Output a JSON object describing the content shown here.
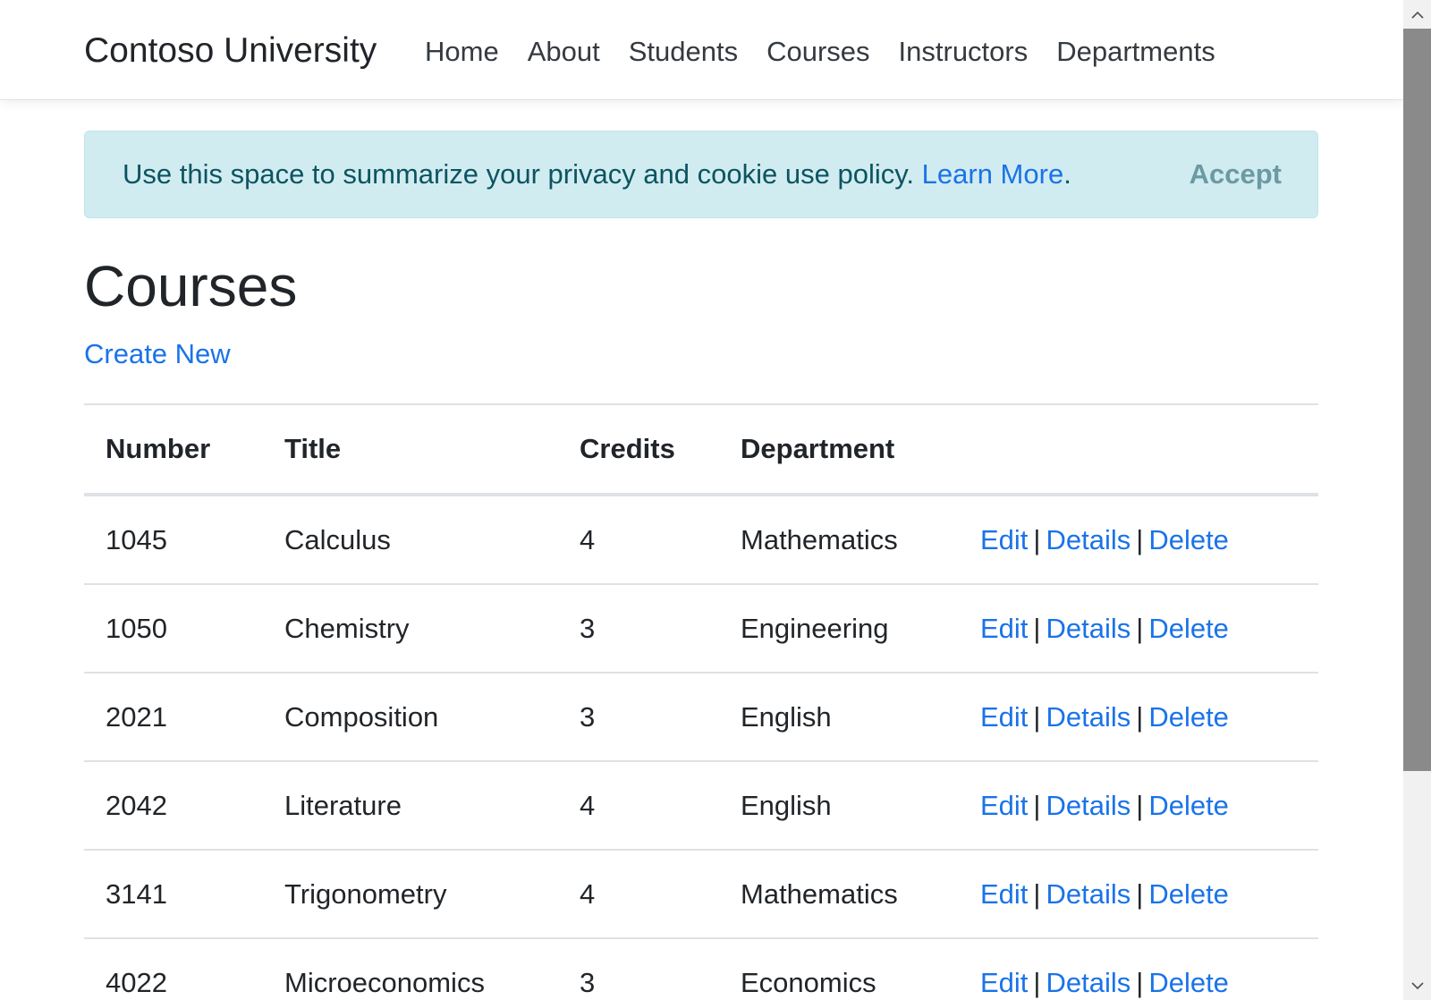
{
  "navbar": {
    "brand": "Contoso University",
    "items": [
      {
        "label": "Home"
      },
      {
        "label": "About"
      },
      {
        "label": "Students"
      },
      {
        "label": "Courses"
      },
      {
        "label": "Instructors"
      },
      {
        "label": "Departments"
      }
    ]
  },
  "cookie_alert": {
    "text": "Use this space to summarize your privacy and cookie use policy.",
    "link_label": "Learn More",
    "trailing": ".",
    "accept_label": "Accept",
    "bg_color": "#d1ecf1",
    "text_color": "#0c5460"
  },
  "main": {
    "title": "Courses",
    "create_new_label": "Create New"
  },
  "table": {
    "headers": [
      "Number",
      "Title",
      "Credits",
      "Department"
    ],
    "action_labels": {
      "edit": "Edit",
      "details": "Details",
      "delete": "Delete",
      "separator": "|"
    },
    "rows": [
      {
        "number": "1045",
        "title": "Calculus",
        "credits": "4",
        "department": "Mathematics"
      },
      {
        "number": "1050",
        "title": "Chemistry",
        "credits": "3",
        "department": "Engineering"
      },
      {
        "number": "2021",
        "title": "Composition",
        "credits": "3",
        "department": "English"
      },
      {
        "number": "2042",
        "title": "Literature",
        "credits": "4",
        "department": "English"
      },
      {
        "number": "3141",
        "title": "Trigonometry",
        "credits": "4",
        "department": "Mathematics"
      },
      {
        "number": "4022",
        "title": "Microeconomics",
        "credits": "3",
        "department": "Economics"
      }
    ]
  },
  "scrollbar": {
    "up_icon": "chevron-up-icon",
    "down_icon": "chevron-down-icon",
    "scroll_position": 0
  },
  "colors": {
    "link": "#1a73e8",
    "text": "#212529"
  }
}
